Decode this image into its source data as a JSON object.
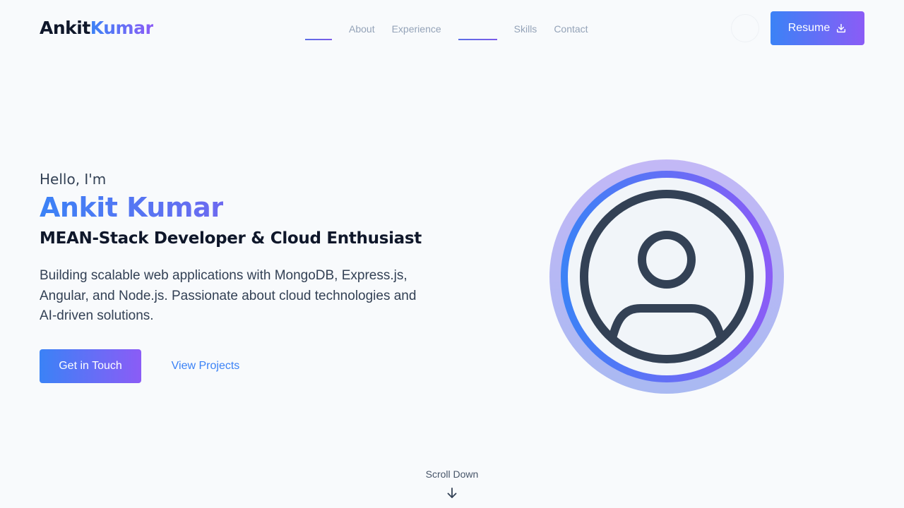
{
  "header": {
    "logo": {
      "first": "Ankit",
      "second": "Kumar"
    },
    "nav": {
      "items": [
        {
          "label": "",
          "active": true
        },
        {
          "label": "About"
        },
        {
          "label": "Experience"
        },
        {
          "label": "",
          "active": true
        },
        {
          "label": "Skills"
        },
        {
          "label": "Contact"
        }
      ]
    },
    "theme_toggle_icon": "theme-toggle-icon",
    "resume": {
      "label": "Resume",
      "icon": "download-icon"
    }
  },
  "hero": {
    "greeting": "Hello, I'm",
    "name": "Ankit Kumar",
    "role": "MEAN-Stack Developer & Cloud Enthusiast",
    "description": "Building scalable web applications with MongoDB, Express.js, Angular, and Node.js. Passionate about cloud technologies and AI-driven solutions.",
    "primary_cta": "Get in Touch",
    "secondary_cta": "View Projects",
    "avatar_icon": "user-profile-icon"
  },
  "scroll": {
    "label": "Scroll Down",
    "icon": "arrow-down-icon"
  },
  "colors": {
    "background": "#f8fafc",
    "gradient_start": "#3b82f6",
    "gradient_end": "#8b5cf6",
    "heading": "#0f172a",
    "body_text": "#334155",
    "nav_text": "#94a3b8",
    "avatar_stroke": "#334155"
  }
}
